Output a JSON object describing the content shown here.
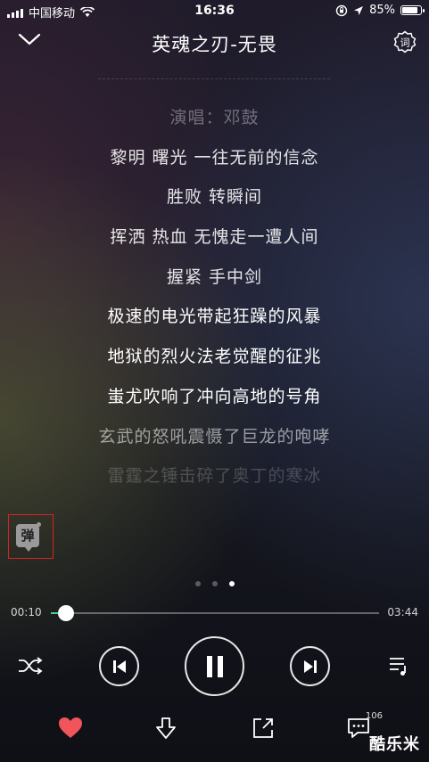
{
  "status_bar": {
    "carrier": "中国移动",
    "time": "16:36",
    "battery": "85%"
  },
  "header": {
    "title": "英魂之刃-无畏",
    "lyric_settings_label": "词"
  },
  "lyrics": [
    "演唱：邓鼓",
    "黎明 曙光 一往无前的信念",
    "胜败 转瞬间",
    "挥洒 热血 无愧走一遭人间",
    "握紧 手中剑",
    "极速的电光带起狂躁的风暴",
    "地狱的烈火法老觉醒的征兆",
    "蚩尤吹响了冲向高地的号角",
    "玄武的怒吼震慑了巨龙的咆哮",
    "雷霆之锤击碎了奥丁的寒冰"
  ],
  "danmu": {
    "label": "弹"
  },
  "pager": {
    "count": 3,
    "active": 2
  },
  "player": {
    "elapsed": "00:10",
    "total": "03:44",
    "progress": 0.045,
    "accent": "#3fd68c"
  },
  "bottom": {
    "comment_count": "106",
    "like_color": "#f2545b"
  },
  "watermark": "酷乐米"
}
